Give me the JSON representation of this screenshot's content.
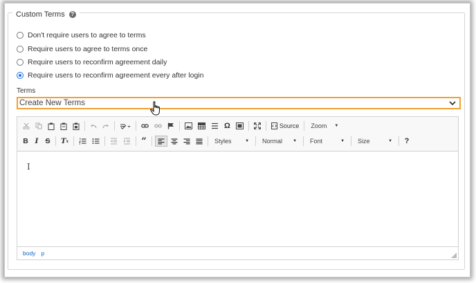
{
  "section": {
    "title": "Custom Terms",
    "help_icon": "question-circle-icon"
  },
  "options": [
    {
      "label": "Don't require users to agree to terms",
      "checked": false
    },
    {
      "label": "Require users to agree to terms once",
      "checked": false
    },
    {
      "label": "Require users to reconfirm agreement daily",
      "checked": false
    },
    {
      "label": "Require users to reconfirm agreement every after login",
      "checked": true
    }
  ],
  "terms": {
    "label": "Terms",
    "selected": "Create New Terms"
  },
  "toolbar": {
    "source_label": "Source",
    "zoom_label": "Zoom",
    "styles_label": "Styles",
    "format_label": "Normal",
    "font_label": "Font",
    "size_label": "Size",
    "help_label": "?"
  },
  "statusbar": {
    "path": [
      "body",
      "p"
    ]
  },
  "colors": {
    "select_border": "#f0a030",
    "radio_checked": "#1a73e8",
    "status_link": "#1565c0"
  }
}
